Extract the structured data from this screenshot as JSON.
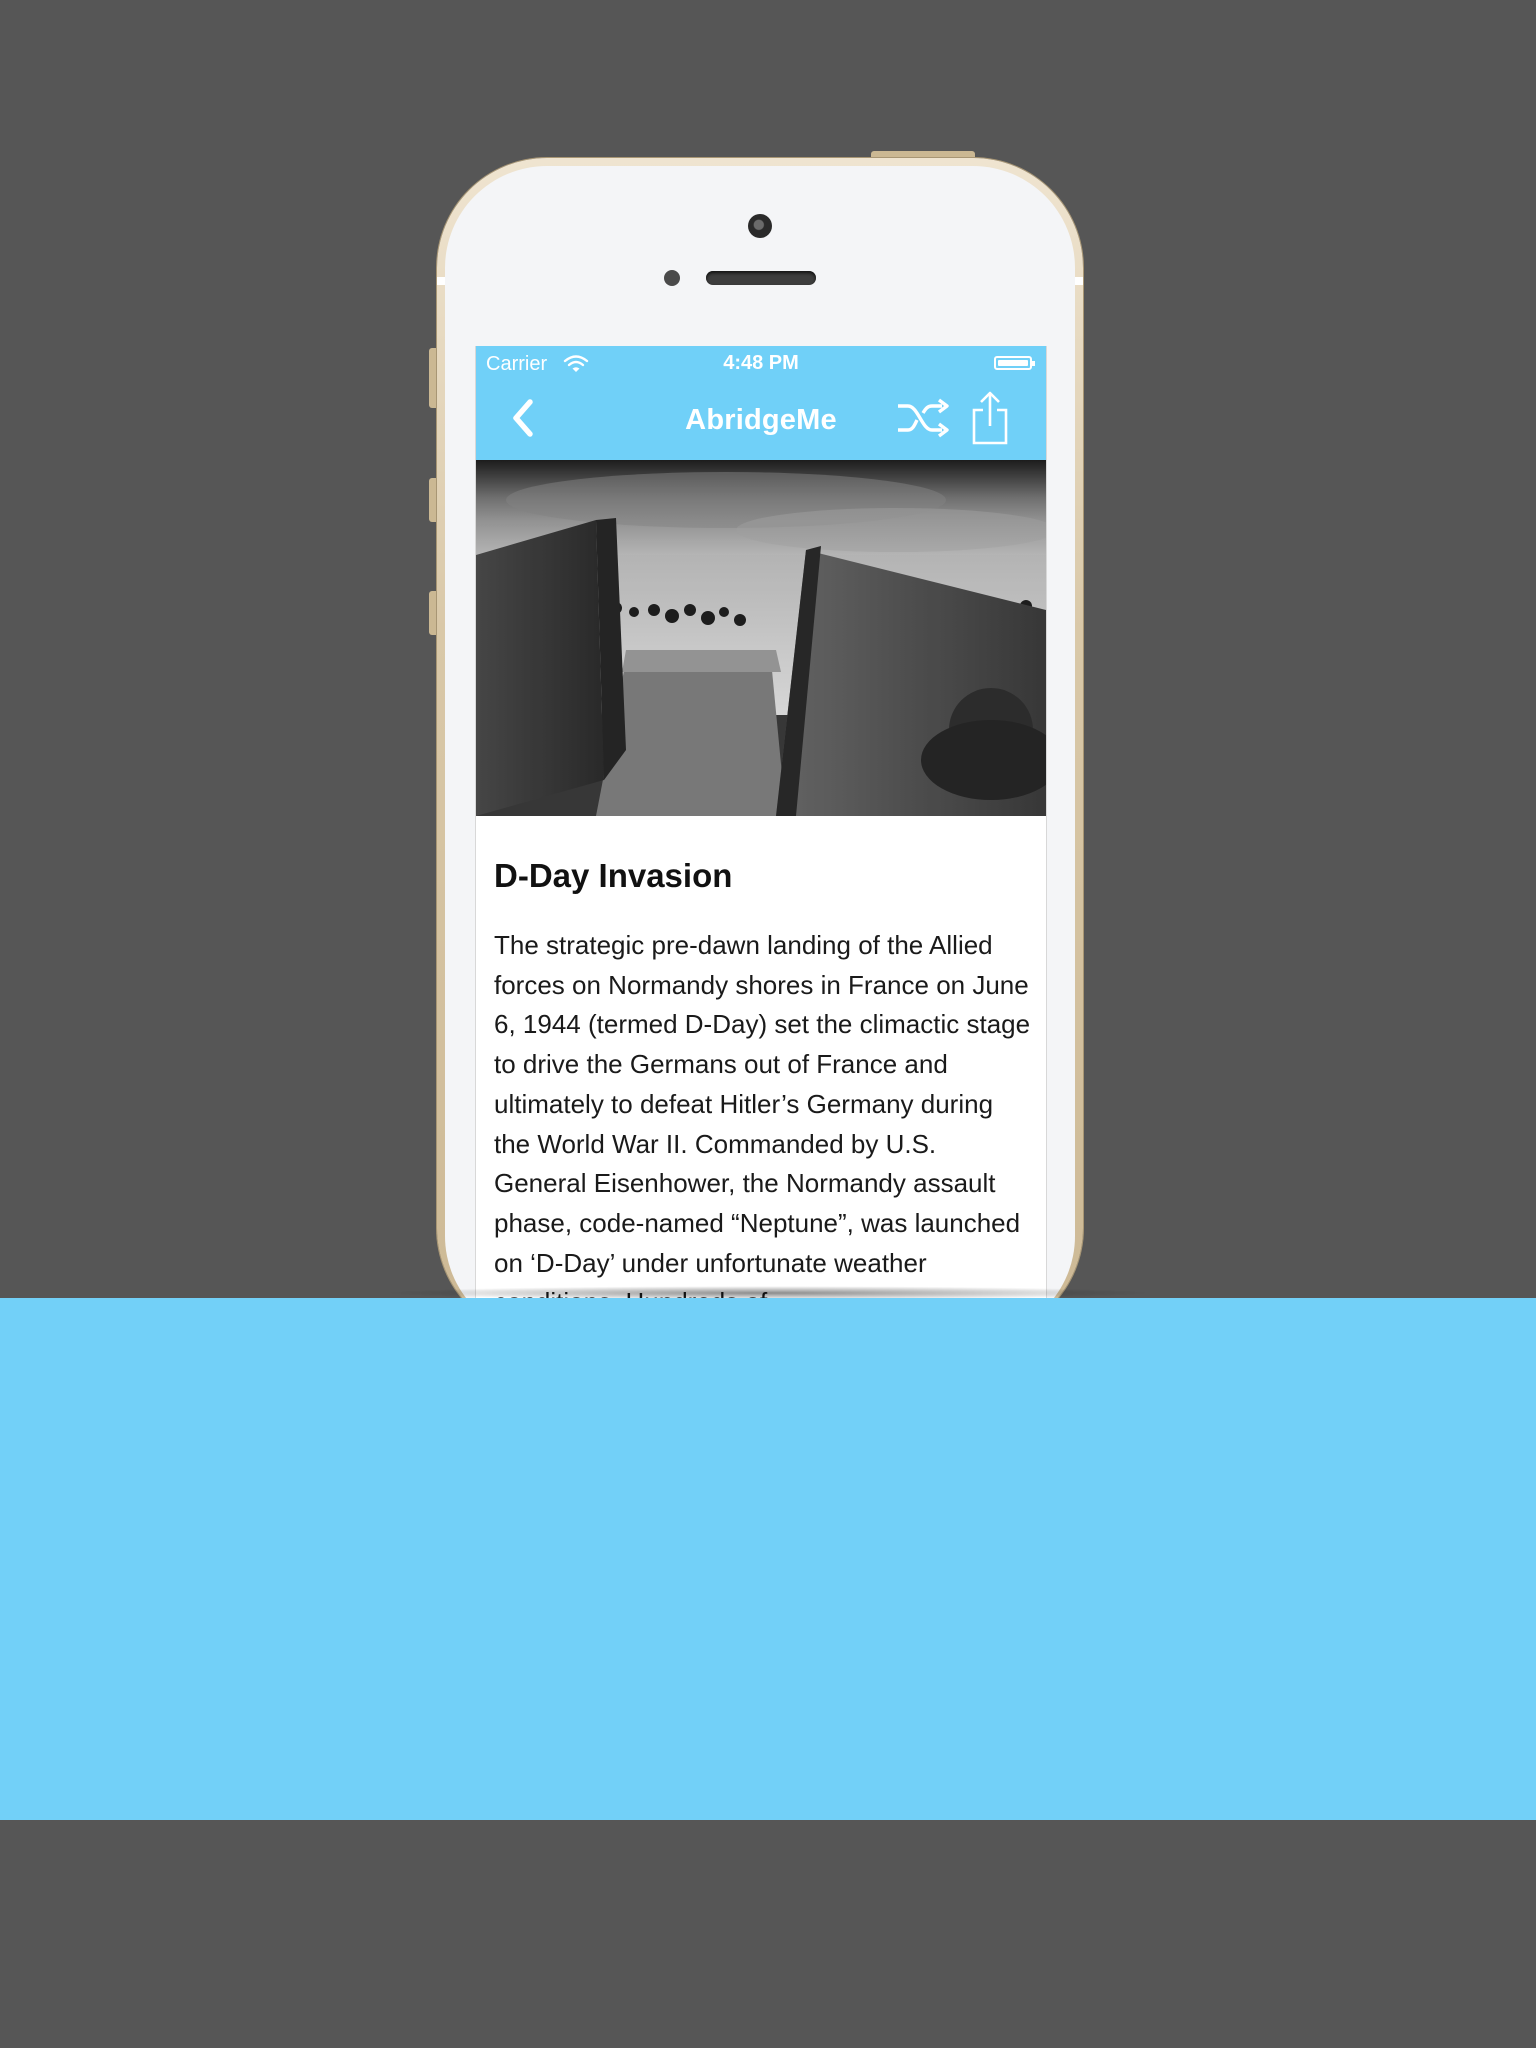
{
  "statusbar": {
    "carrier": "Carrier",
    "time": "4:48 PM"
  },
  "navbar": {
    "title": "AbridgeMe",
    "back_icon": "chevron-left-icon",
    "shuffle_icon": "shuffle-icon",
    "share_icon": "share-icon"
  },
  "article": {
    "title": "D-Day Invasion",
    "body": "The strategic pre-dawn landing of the Allied forces on Normandy shores in France on June 6, 1944 (termed D-Day) set the climactic stage to drive the Germans out of France and ultimately to defeat Hitler’s Germany during the World War II. Commanded by U.S. General Eisenhower, the Normandy assault phase, code-named “Neptune”, was launched on ‘D-Day’ under unfortunate weather conditions. Hundreds of",
    "image": "landing-craft-beach-photo"
  },
  "colors": {
    "accent": "#70d0f8",
    "background": "#565656",
    "band": "#72d0f8"
  }
}
